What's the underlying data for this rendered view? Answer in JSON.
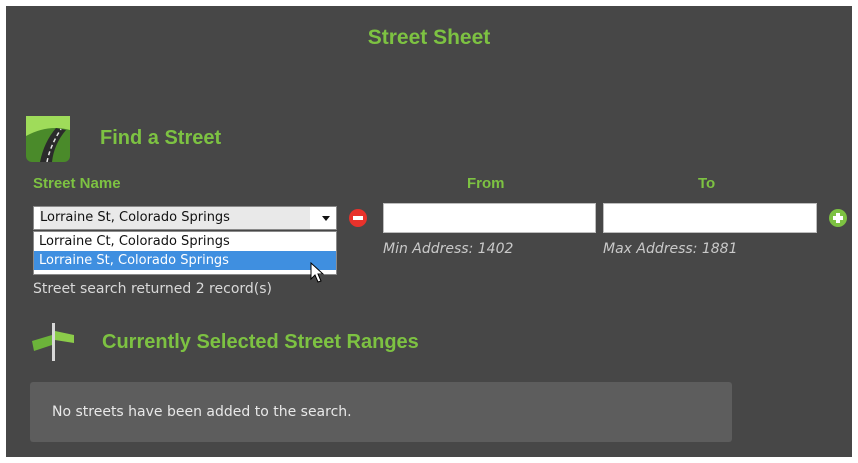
{
  "header": {
    "title": "Street Sheet"
  },
  "find_section": {
    "title": "Find a Street",
    "icon": "road-icon",
    "labels": {
      "street_name": "Street Name",
      "from": "From",
      "to": "To"
    },
    "street_select": {
      "selected": "Lorraine St, Colorado Springs",
      "options": [
        "Lorraine Ct, Colorado Springs",
        "Lorraine St, Colorado Springs"
      ],
      "highlighted_index": 1
    },
    "from_input": {
      "value": "",
      "hint": "Min Address: 1402"
    },
    "to_input": {
      "value": "",
      "hint": "Max Address: 1881"
    },
    "status": "Street search returned 2 record(s)"
  },
  "ranges_section": {
    "title": "Currently Selected Street Ranges",
    "icon": "street-sign-icon",
    "empty_message": "No streets have been added to the search."
  },
  "colors": {
    "accent": "#7dc242",
    "remove": "#e8322b",
    "add": "#7dc242",
    "selection": "#3f8fe0"
  }
}
